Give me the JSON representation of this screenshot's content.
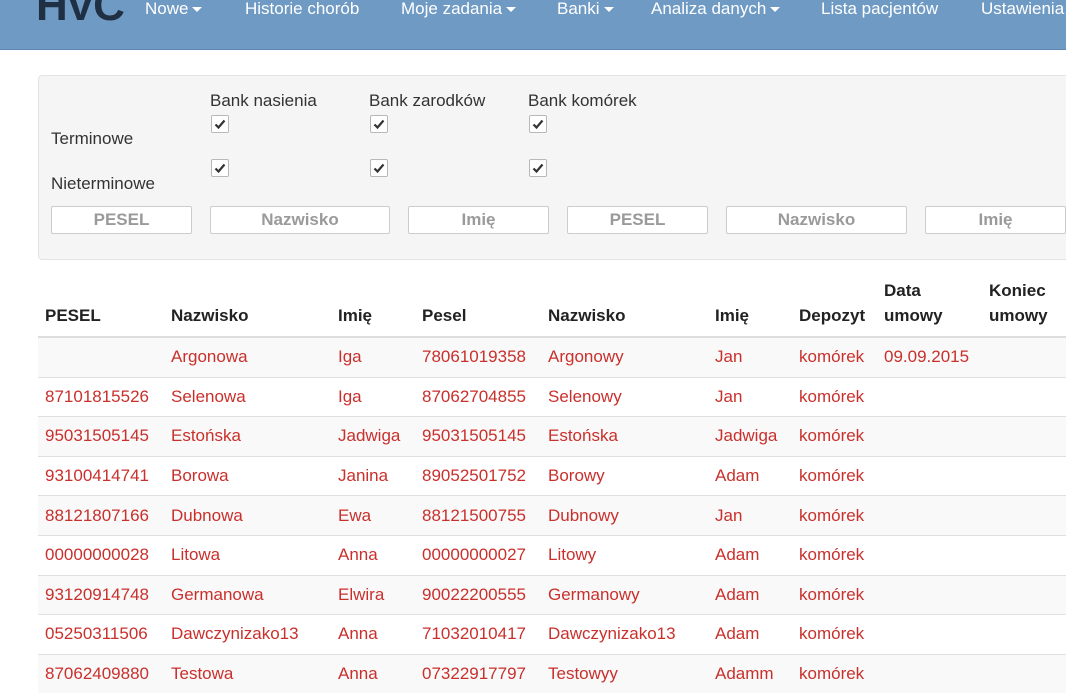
{
  "navbar": {
    "logo": "HVC",
    "items": [
      {
        "label": "Nowe",
        "dropdown": true
      },
      {
        "label": "Historie chorób",
        "dropdown": false
      },
      {
        "label": "Moje zadania",
        "dropdown": true
      },
      {
        "label": "Banki",
        "dropdown": true
      },
      {
        "label": "Analiza danych",
        "dropdown": true
      },
      {
        "label": "Lista pacjentów",
        "dropdown": false
      },
      {
        "label": "Ustawienia",
        "dropdown": false
      }
    ]
  },
  "filters": {
    "banks": [
      "Bank nasienia",
      "Bank zarodków",
      "Bank komórek"
    ],
    "rows": [
      "Terminowe",
      "Nieterminowe"
    ],
    "checked": [
      [
        true,
        true,
        true
      ],
      [
        true,
        true,
        true
      ]
    ],
    "inputs": [
      {
        "placeholder": "PESEL",
        "value": ""
      },
      {
        "placeholder": "Nazwisko",
        "value": ""
      },
      {
        "placeholder": "Imię",
        "value": ""
      },
      {
        "placeholder": "PESEL",
        "value": ""
      },
      {
        "placeholder": "Nazwisko",
        "value": ""
      },
      {
        "placeholder": "Imię",
        "value": ""
      }
    ]
  },
  "table": {
    "headers": [
      "PESEL",
      "Nazwisko",
      "Imię",
      "Pesel",
      "Nazwisko",
      "Imię",
      "Depozyt",
      "Data umowy",
      "Koniec umowy"
    ],
    "rows": [
      [
        "",
        "Argonowa",
        "Iga",
        "78061019358",
        "Argonowy",
        "Jan",
        "komórek",
        "09.09.2015",
        ""
      ],
      [
        "87101815526",
        "Selenowa",
        "Iga",
        "87062704855",
        "Selenowy",
        "Jan",
        "komórek",
        "",
        ""
      ],
      [
        "95031505145",
        "Estońska",
        "Jadwiga",
        "95031505145",
        "Estońska",
        "Jadwiga",
        "komórek",
        "",
        ""
      ],
      [
        "93100414741",
        "Borowa",
        "Janina",
        "89052501752",
        "Borowy",
        "Adam",
        "komórek",
        "",
        ""
      ],
      [
        "88121807166",
        "Dubnowa",
        "Ewa",
        "88121500755",
        "Dubnowy",
        "Jan",
        "komórek",
        "",
        ""
      ],
      [
        "00000000028",
        "Litowa",
        "Anna",
        "00000000027",
        "Litowy",
        "Adam",
        "komórek",
        "",
        ""
      ],
      [
        "93120914748",
        "Germanowa",
        "Elwira",
        "90022200555",
        "Germanowy",
        "Adam",
        "komórek",
        "",
        ""
      ],
      [
        "05250311506",
        "Dawczynizako13",
        "Anna",
        "71032010417",
        "Dawczynizako13",
        "Adam",
        "komórek",
        "",
        ""
      ],
      [
        "87062409880",
        "Testowa",
        "Anna",
        "07322917797",
        "Testowyy",
        "Adamm",
        "komórek",
        "",
        ""
      ]
    ]
  }
}
